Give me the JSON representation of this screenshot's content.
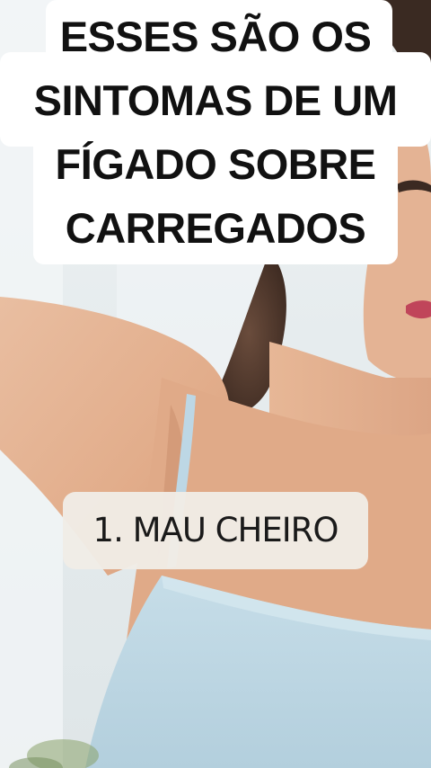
{
  "title": {
    "lines": [
      "ESSES SÃO OS",
      "SINTOMAS DE UM",
      "FÍGADO SOBRE",
      "CARREGADOS"
    ]
  },
  "caption": {
    "text": "1. MAU CHEIRO"
  },
  "colors": {
    "card_background": "#ffffff",
    "title_text": "#111111",
    "pill_background": "#f0ece6",
    "caption_text": "#1a1a1a",
    "top_background": "#e8eef0",
    "skin": "#e4b18f",
    "top_garment": "#bcd6e4"
  }
}
